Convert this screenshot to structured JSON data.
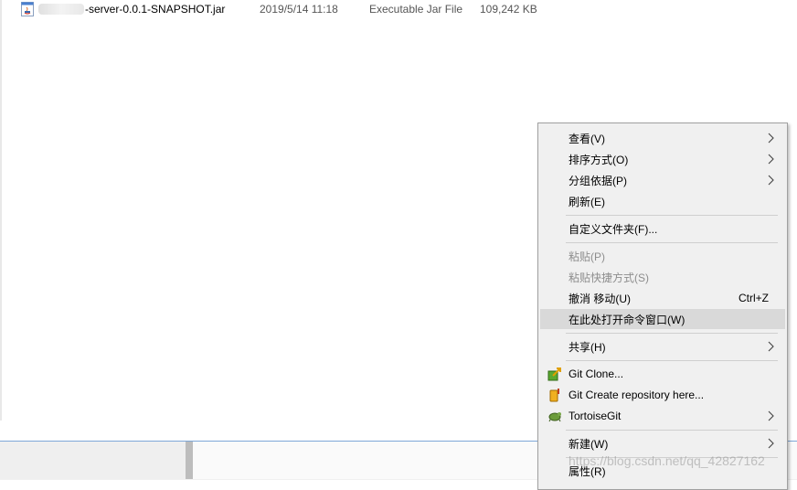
{
  "file": {
    "name": "-server-0.0.1-SNAPSHOT.jar",
    "date": "2019/5/14 11:18",
    "type": "Executable Jar File",
    "size": "109,242 KB"
  },
  "menu": {
    "items": [
      {
        "label": "查看(V)",
        "submenu": true,
        "disabled": false
      },
      {
        "label": "排序方式(O)",
        "submenu": true,
        "disabled": false
      },
      {
        "label": "分组依据(P)",
        "submenu": true,
        "disabled": false
      },
      {
        "label": "刷新(E)",
        "submenu": false,
        "disabled": false
      },
      {
        "label": "自定义文件夹(F)...",
        "submenu": false,
        "disabled": false
      },
      {
        "label": "粘贴(P)",
        "submenu": false,
        "disabled": true
      },
      {
        "label": "粘贴快捷方式(S)",
        "submenu": false,
        "disabled": true
      },
      {
        "label": "撤消 移动(U)",
        "shortcut": "Ctrl+Z",
        "submenu": false,
        "disabled": false
      },
      {
        "label": "在此处打开命令窗口(W)",
        "submenu": false,
        "disabled": false,
        "highlighted": true
      },
      {
        "label": "共享(H)",
        "submenu": true,
        "disabled": false
      },
      {
        "label": "Git Clone...",
        "icon": "git-clone-icon",
        "submenu": false,
        "disabled": false
      },
      {
        "label": "Git Create repository here...",
        "icon": "git-create-repo-icon",
        "submenu": false,
        "disabled": false
      },
      {
        "label": "TortoiseGit",
        "icon": "tortoisegit-icon",
        "submenu": true,
        "disabled": false
      },
      {
        "label": "新建(W)",
        "submenu": true,
        "disabled": false
      },
      {
        "label": "属性(R)",
        "submenu": false,
        "disabled": false
      }
    ]
  },
  "watermark": "https://blog.csdn.net/qq_42827162",
  "colors": {
    "menu_bg": "#f0f0f0",
    "menu_hover": "#d9d9d9",
    "disabled_text": "#8d8d8d",
    "bottom_border": "#7ea7d8"
  }
}
